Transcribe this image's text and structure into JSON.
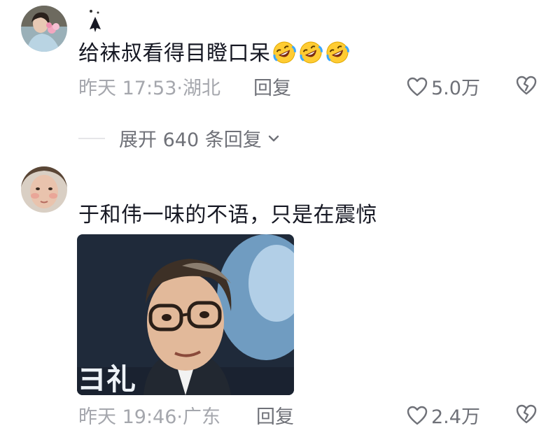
{
  "comments": [
    {
      "username": "✦",
      "text": "给袜叔看得目瞪口呆",
      "emojis": [
        "rolling-on-floor-laughing-emoji",
        "rolling-on-floor-laughing-emoji",
        "rolling-on-floor-laughing-emoji"
      ],
      "time_location": "昨天 17:53·湖北",
      "reply_label": "回复",
      "like_count": "5.0万",
      "expand_label": "展开 640 条回复"
    },
    {
      "username": "",
      "text": "于和伟一味的不语，只是在震惊",
      "image_text": "ヨ礼",
      "time_location": "昨天 19:46·广东",
      "reply_label": "回复",
      "like_count": "2.4万"
    }
  ],
  "colors": {
    "text_primary": "#161823",
    "meta_text": "#a5a7ad",
    "action_text": "#6f7178",
    "divider": "#e6e6e8"
  },
  "icons": [
    "heart-outline-icon",
    "broken-heart-icon",
    "chevron-down-icon"
  ]
}
